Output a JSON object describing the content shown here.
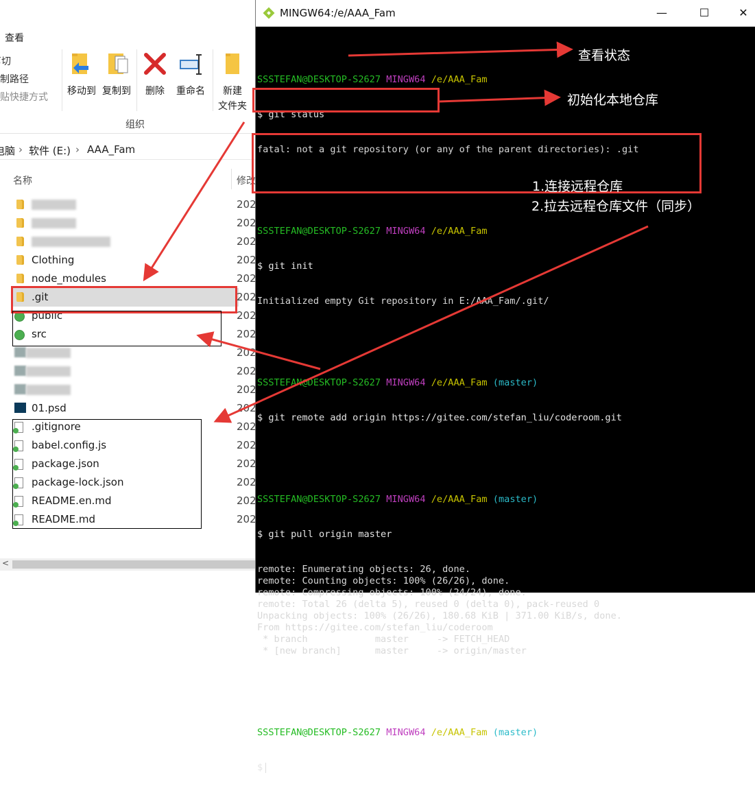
{
  "explorer": {
    "ribbon_tab": "查看",
    "clipboard": [
      "剪切",
      "复制路径",
      "粘贴快捷方式"
    ],
    "buttons": {
      "move_to": "移动到",
      "copy_to": "复制到",
      "delete": "删除",
      "rename": "重命名",
      "new_folder_line1": "新建",
      "new_folder_line2": "文件夹"
    },
    "group_label": "组织",
    "breadcrumb": {
      "pc": "电脑",
      "drive": "软件 (E:)",
      "folder": "AAA_Fam"
    },
    "columns": {
      "name": "名称",
      "modified": "修改"
    },
    "rows": [
      {
        "name": "",
        "date": "202",
        "kind": "folder",
        "blur": 1
      },
      {
        "name": "",
        "date": "202",
        "kind": "folder",
        "blur": 1
      },
      {
        "name": "",
        "date": "202",
        "kind": "folder",
        "blur": 1
      },
      {
        "name": "Clothing",
        "date": "202",
        "kind": "folder"
      },
      {
        "name": "node_modules",
        "date": "202",
        "kind": "folder"
      },
      {
        "name": ".git",
        "date": "202",
        "kind": "folder-selected"
      },
      {
        "name": "public",
        "date": "202",
        "kind": "green"
      },
      {
        "name": "src",
        "date": "202",
        "kind": "green"
      },
      {
        "name": "",
        "date": "202",
        "kind": "blur"
      },
      {
        "name": "",
        "date": "202",
        "kind": "blur"
      },
      {
        "name": "",
        "date": "202",
        "kind": "blur"
      },
      {
        "name": "01.psd",
        "date": "202",
        "kind": "psd"
      },
      {
        "name": ".gitignore",
        "date": "202",
        "kind": "file"
      },
      {
        "name": "babel.config.js",
        "date": "202",
        "kind": "file"
      },
      {
        "name": "package.json",
        "date": "202",
        "kind": "file"
      },
      {
        "name": "package-lock.json",
        "date": "202",
        "kind": "file"
      },
      {
        "name": "README.en.md",
        "date": "202",
        "kind": "file"
      },
      {
        "name": "README.md",
        "date": "202",
        "kind": "file"
      }
    ]
  },
  "terminal": {
    "title": "MINGW64:/e/AAA_Fam",
    "user": "SSSTEFAN@DESKTOP-S2627",
    "env": "MINGW64",
    "path": "/e/AAA_Fam",
    "branch": "(master)",
    "commands": {
      "status": "$ git status",
      "status_out": "fatal: not a git repository (or any of the parent directories): .git",
      "init": "$ git init",
      "init_out": "Initialized empty Git repository in E:/AAA_Fam/.git/",
      "remote": "$ git remote add origin https://gitee.com/stefan_liu/coderoom.git",
      "pull": "$ git pull origin master",
      "prompt": "$"
    },
    "pull_output": [
      "remote: Enumerating objects: 26, done.",
      "remote: Counting objects: 100% (26/26), done.",
      "remote: Compressing objects: 100% (24/24), done.",
      "remote: Total 26 (delta 5), reused 0 (delta 0), pack-reused 0",
      "Unpacking objects: 100% (26/26), 180.68 KiB | 371.00 KiB/s, done.",
      "From https://gitee.com/stefan_liu/coderoom",
      " * branch            master     -> FETCH_HEAD",
      " * [new branch]      master     -> origin/master"
    ]
  },
  "annotations": {
    "view_status": "查看状态",
    "init_local": "初始化本地仓库",
    "connect_remote": "1.连接远程仓库",
    "pull_files": "2.拉去远程仓库文件（同步）"
  },
  "colors": {
    "annotation_red": "#e53935",
    "prompt_green": "#25bc24",
    "prompt_magenta": "#bf3fbf",
    "prompt_yellow": "#c7c400",
    "prompt_cyan": "#2bbbc9"
  }
}
